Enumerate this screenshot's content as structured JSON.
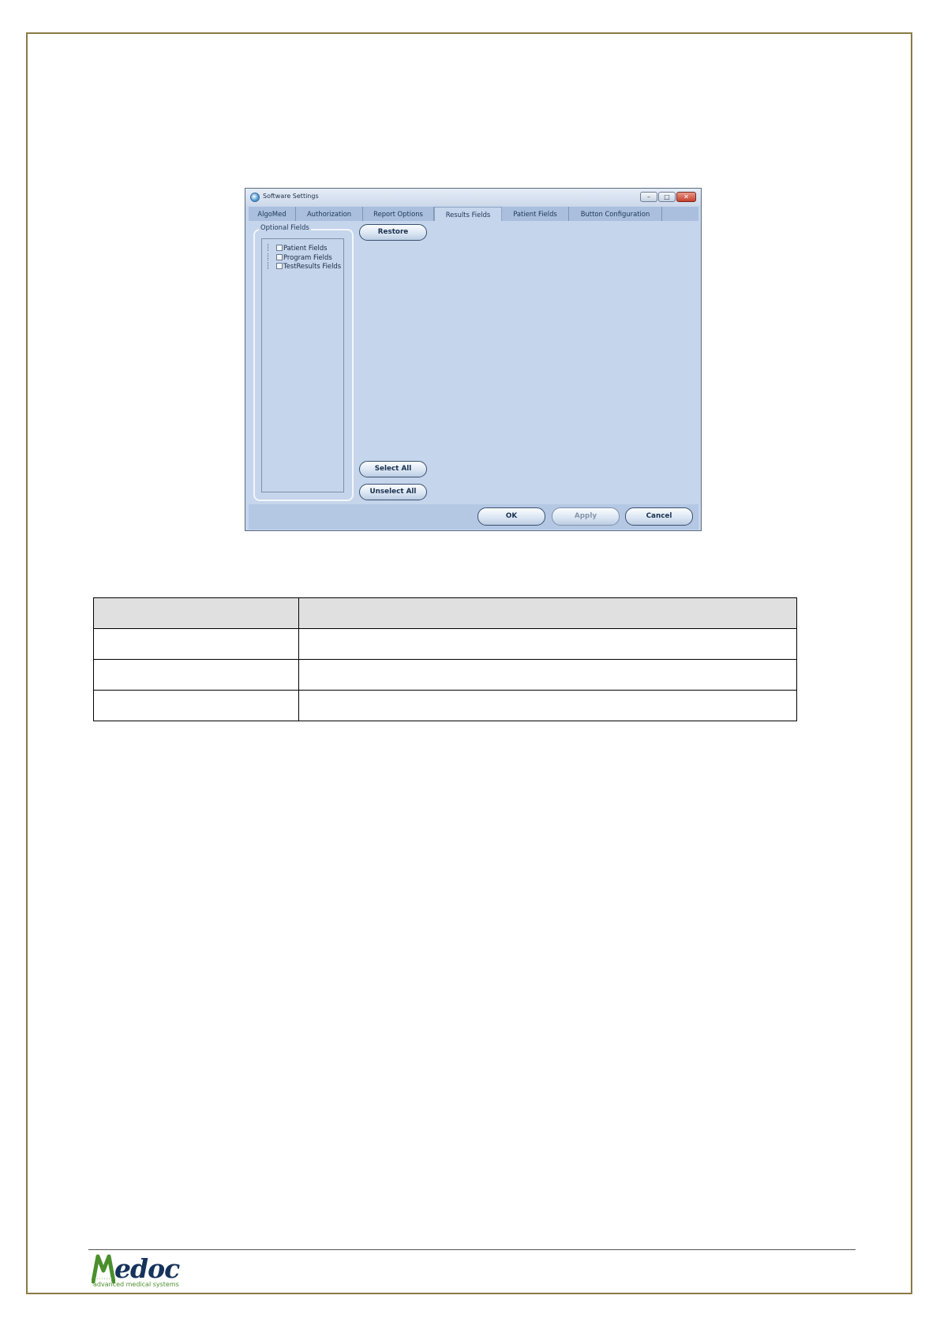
{
  "dialog": {
    "title": "Software Settings",
    "window_buttons": {
      "minimize": "–",
      "maximize": "□",
      "close": "✕"
    },
    "tabs": [
      {
        "label": "AlgoMed",
        "active": false
      },
      {
        "label": "Authorization",
        "active": false
      },
      {
        "label": "Report Options",
        "active": false
      },
      {
        "label": "Results Fields",
        "active": true
      },
      {
        "label": "Patient Fields",
        "active": false
      },
      {
        "label": "Button Configuration",
        "active": false
      }
    ],
    "group_label": "Optional Fields",
    "tree_items": [
      {
        "label": "Patient Fields",
        "checked": false
      },
      {
        "label": "Program Fields",
        "checked": false
      },
      {
        "label": "TestResults Fields",
        "checked": false
      }
    ],
    "buttons": {
      "restore": "Restore",
      "select_all": "Select All",
      "unselect_all": "Unselect All",
      "ok": "OK",
      "apply": "Apply",
      "cancel": "Cancel"
    },
    "colors": {
      "background": "#c5d5eb",
      "tabbar": "#a9bfdd",
      "close": "#c6402e"
    }
  },
  "table": {
    "header": [
      "",
      ""
    ],
    "rows": [
      [
        "",
        ""
      ],
      [
        "",
        ""
      ],
      [
        "",
        ""
      ]
    ]
  },
  "footer": {
    "logo_text": "edoc",
    "logo_tagline": "advanced medical systems",
    "colors": {
      "logo_green": "#4a8f2c",
      "logo_navy": "#16335b"
    }
  }
}
